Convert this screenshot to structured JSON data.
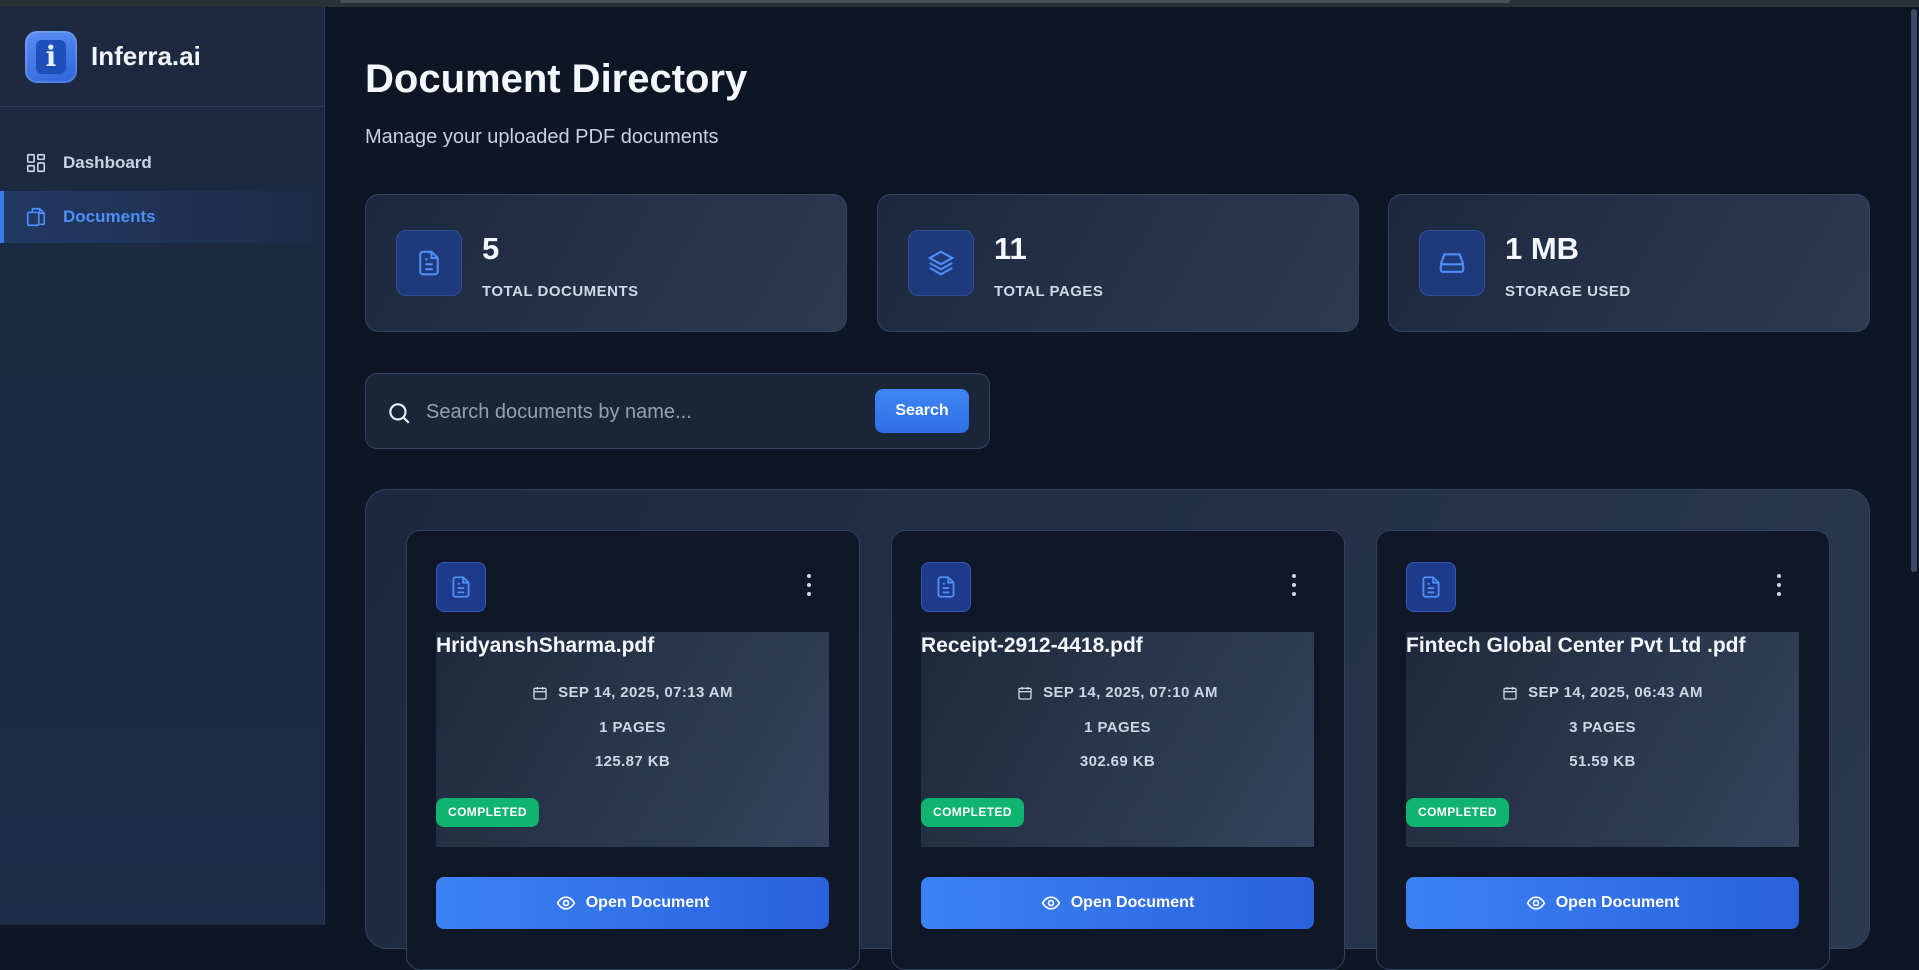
{
  "brand": {
    "name": "Inferra.ai",
    "logo_glyph": "i"
  },
  "sidebar": {
    "items": [
      {
        "label": "Dashboard",
        "icon": "dashboard-grid-icon",
        "active": false
      },
      {
        "label": "Documents",
        "icon": "documents-icon",
        "active": true
      }
    ]
  },
  "header": {
    "title": "Document Directory",
    "subtitle": "Manage your uploaded PDF documents"
  },
  "stats": [
    {
      "value": "5",
      "label": "TOTAL DOCUMENTS",
      "icon": "file-text-icon"
    },
    {
      "value": "11",
      "label": "TOTAL PAGES",
      "icon": "layers-icon"
    },
    {
      "value": "1 MB",
      "label": "STORAGE USED",
      "icon": "hard-drive-icon"
    }
  ],
  "search": {
    "placeholder": "Search documents by name...",
    "value": "",
    "button_label": "Search"
  },
  "documents": [
    {
      "name": "HridyanshSharma.pdf",
      "date": "SEP 14, 2025, 07:13 AM",
      "pages": "1 PAGES",
      "size": "125.87 KB",
      "status": "COMPLETED",
      "action": "Open Document"
    },
    {
      "name": "Receipt-2912-4418.pdf",
      "date": "SEP 14, 2025, 07:10 AM",
      "pages": "1 PAGES",
      "size": "302.69 KB",
      "status": "COMPLETED",
      "action": "Open Document"
    },
    {
      "name": "Fintech Global Center Pvt Ltd .pdf",
      "date": "SEP 14, 2025, 06:43 AM",
      "pages": "3 PAGES",
      "size": "51.59 KB",
      "status": "COMPLETED",
      "action": "Open Document"
    }
  ],
  "colors": {
    "background": "#0e1626",
    "accent": "#3b82f6",
    "status_completed": "#10b36f"
  }
}
